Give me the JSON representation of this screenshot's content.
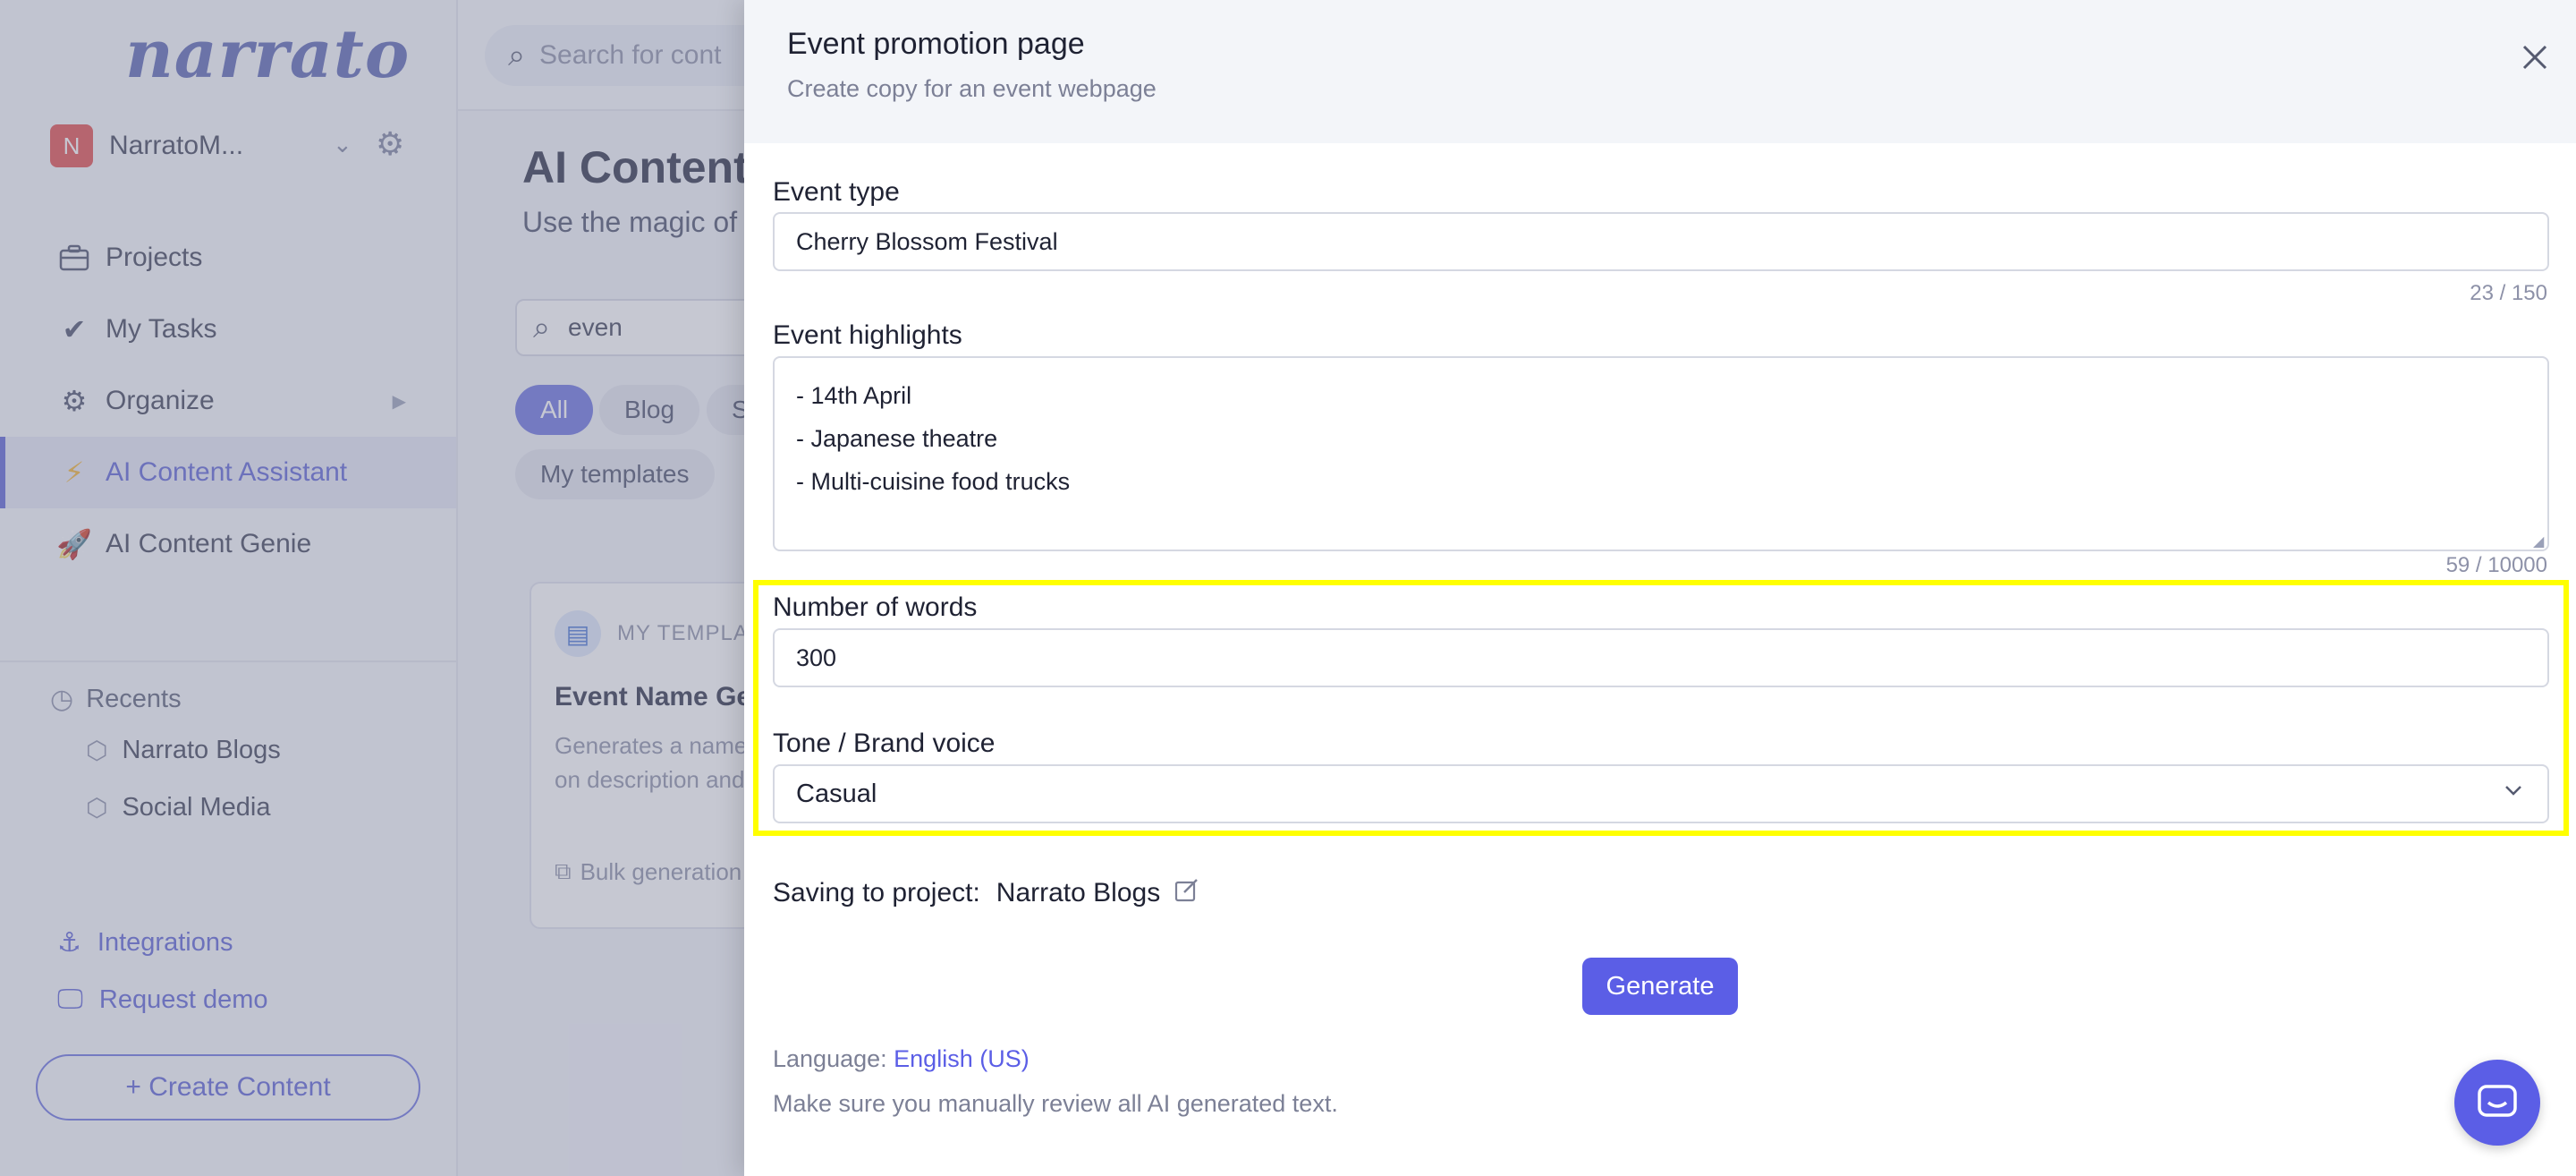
{
  "app": {
    "logo": "narrato",
    "workspace": {
      "avatar_letter": "N",
      "name": "NarratoM..."
    },
    "nav": [
      {
        "label": "Projects"
      },
      {
        "label": "My Tasks"
      },
      {
        "label": "Organize"
      },
      {
        "label": "AI Content Assistant"
      },
      {
        "label": "AI Content Genie"
      }
    ],
    "recents": {
      "heading": "Recents",
      "items": [
        {
          "label": "Narrato Blogs"
        },
        {
          "label": "Social Media"
        }
      ]
    },
    "bottom_links": [
      {
        "label": "Integrations"
      },
      {
        "label": "Request demo"
      }
    ],
    "create_button": "+ Create Content"
  },
  "main": {
    "search_placeholder": "Search for cont",
    "title": "AI Content",
    "subtitle": "Use the magic of",
    "template_search_value": "even",
    "chips": [
      {
        "label": "All"
      },
      {
        "label": "Blog"
      },
      {
        "label": "S"
      },
      {
        "label": "My templates"
      }
    ],
    "card": {
      "tag": "MY TEMPLA",
      "title": "Event Name Ger",
      "desc_line1": "Generates a name",
      "desc_line2": "on description and",
      "footer": "Bulk generation"
    }
  },
  "drawer": {
    "title": "Event promotion page",
    "subtitle": "Create copy for an event webpage",
    "fields": {
      "event_type": {
        "label": "Event type",
        "value": "Cherry Blossom Festival",
        "counter": "23 / 150"
      },
      "event_highlights": {
        "label": "Event highlights",
        "value": "- 14th April\n- Japanese theatre\n- Multi-cuisine food trucks",
        "counter": "59 / 10000"
      },
      "number_of_words": {
        "label": "Number of words",
        "value": "300"
      },
      "tone": {
        "label": "Tone / Brand voice",
        "value": "Casual"
      }
    },
    "saving": {
      "label": "Saving to project:",
      "project": "Narrato Blogs"
    },
    "generate_label": "Generate",
    "language": {
      "label": "Language:",
      "value": "English (US)"
    },
    "review_note": "Make sure you manually review all AI generated text."
  },
  "colors": {
    "accent": "#5b5ee6",
    "highlight": "#ffff00"
  }
}
